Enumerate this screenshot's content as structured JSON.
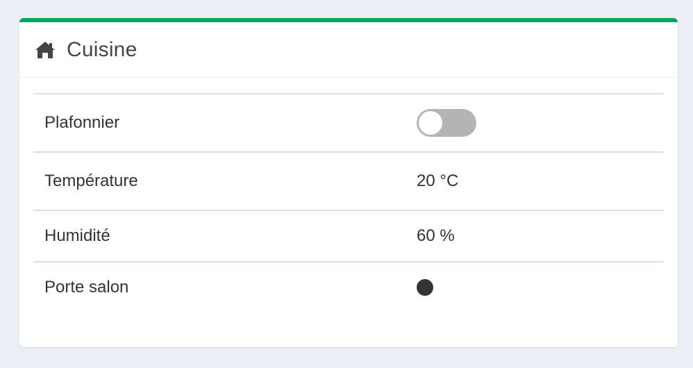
{
  "panel": {
    "title": "Cuisine",
    "title_icon": "home-icon",
    "accent_color": "#00a65a"
  },
  "rows": [
    {
      "label": "Plafonnier",
      "control": "toggle",
      "state": "off"
    },
    {
      "label": "Température",
      "value": "20 °C"
    },
    {
      "label": "Humidité",
      "value": "60 %"
    },
    {
      "label": "Porte salon",
      "indicator": "status-dot",
      "indicator_color": "#333333"
    }
  ]
}
